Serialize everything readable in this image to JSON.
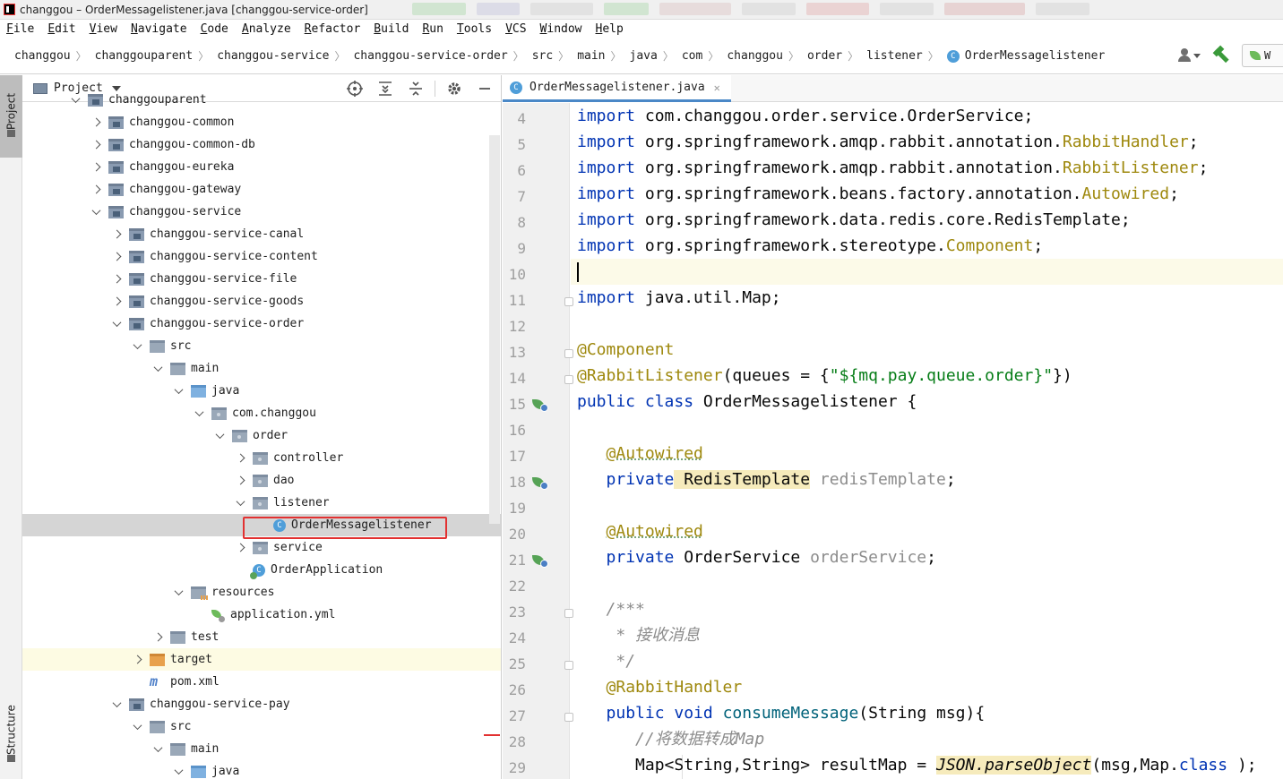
{
  "window": {
    "title": "changgou – OrderMessagelistener.java [changgou-service-order]"
  },
  "menu": [
    "File",
    "Edit",
    "View",
    "Navigate",
    "Code",
    "Analyze",
    "Refactor",
    "Build",
    "Run",
    "Tools",
    "VCS",
    "Window",
    "Help"
  ],
  "breadcrumb": [
    "changgou",
    "changgouparent",
    "changgou-service",
    "changgou-service-order",
    "src",
    "main",
    "java",
    "com",
    "changgou",
    "order",
    "listener",
    "OrderMessagelistener"
  ],
  "toolbar": {
    "run_config_label": "W"
  },
  "left_strip": {
    "project_tab": "Project",
    "structure_tab": "Structure"
  },
  "project_panel": {
    "title": "Project",
    "tree": [
      {
        "label": "changgouparent",
        "icon": "module",
        "depth": 0,
        "arrow": "open"
      },
      {
        "label": "changgou-common",
        "icon": "module",
        "depth": 1,
        "arrow": "closed"
      },
      {
        "label": "changgou-common-db",
        "icon": "module",
        "depth": 1,
        "arrow": "closed"
      },
      {
        "label": "changgou-eureka",
        "icon": "module",
        "depth": 1,
        "arrow": "closed"
      },
      {
        "label": "changgou-gateway",
        "icon": "module",
        "depth": 1,
        "arrow": "closed"
      },
      {
        "label": "changgou-service",
        "icon": "module",
        "depth": 1,
        "arrow": "open"
      },
      {
        "label": "changgou-service-canal",
        "icon": "module",
        "depth": 2,
        "arrow": "closed"
      },
      {
        "label": "changgou-service-content",
        "icon": "module",
        "depth": 2,
        "arrow": "closed"
      },
      {
        "label": "changgou-service-file",
        "icon": "module",
        "depth": 2,
        "arrow": "closed"
      },
      {
        "label": "changgou-service-goods",
        "icon": "module",
        "depth": 2,
        "arrow": "closed"
      },
      {
        "label": "changgou-service-order",
        "icon": "module",
        "depth": 2,
        "arrow": "open"
      },
      {
        "label": "src",
        "icon": "folder",
        "depth": 3,
        "arrow": "open"
      },
      {
        "label": "main",
        "icon": "folder",
        "depth": 4,
        "arrow": "open"
      },
      {
        "label": "java",
        "icon": "folder-blue",
        "depth": 5,
        "arrow": "open"
      },
      {
        "label": "com.changgou",
        "icon": "package",
        "depth": 6,
        "arrow": "open"
      },
      {
        "label": "order",
        "icon": "package",
        "depth": 7,
        "arrow": "open"
      },
      {
        "label": "controller",
        "icon": "package",
        "depth": 8,
        "arrow": "closed"
      },
      {
        "label": "dao",
        "icon": "package",
        "depth": 8,
        "arrow": "closed"
      },
      {
        "label": "listener",
        "icon": "package",
        "depth": 8,
        "arrow": "open"
      },
      {
        "label": "OrderMessagelistener",
        "icon": "class",
        "depth": 9,
        "arrow": "none",
        "selected": true
      },
      {
        "label": "service",
        "icon": "package",
        "depth": 8,
        "arrow": "closed"
      },
      {
        "label": "OrderApplication",
        "icon": "app-class",
        "depth": 8,
        "arrow": "none"
      },
      {
        "label": "resources",
        "icon": "folder-res",
        "depth": 5,
        "arrow": "open"
      },
      {
        "label": "application.yml",
        "icon": "yml",
        "depth": 6,
        "arrow": "none"
      },
      {
        "label": "test",
        "icon": "folder",
        "depth": 4,
        "arrow": "closed"
      },
      {
        "label": "target",
        "icon": "folder-orange",
        "depth": 3,
        "arrow": "closed",
        "highlight": true
      },
      {
        "label": "pom.xml",
        "icon": "maven",
        "depth": 3,
        "arrow": "none"
      },
      {
        "label": "changgou-service-pay",
        "icon": "module",
        "depth": 2,
        "arrow": "open"
      },
      {
        "label": "src",
        "icon": "folder",
        "depth": 3,
        "arrow": "open"
      },
      {
        "label": "main",
        "icon": "folder",
        "depth": 4,
        "arrow": "open"
      },
      {
        "label": "java",
        "icon": "folder-blue",
        "depth": 5,
        "arrow": "open"
      }
    ]
  },
  "editor": {
    "tab_label": "OrderMessagelistener.java",
    "tab_icon": "C",
    "line_numbers": [
      "4",
      "5",
      "6",
      "7",
      "8",
      "9",
      "10",
      "11",
      "12",
      "13",
      "14",
      "15",
      "16",
      "17",
      "18",
      "19",
      "20",
      "21",
      "22",
      "23",
      "24",
      "25",
      "26",
      "27",
      "28",
      "29"
    ],
    "current_line": "10",
    "code_lines": [
      [
        [
          "kw",
          "import"
        ],
        [
          "",
          "com.changgou.order.service.OrderService;"
        ]
      ],
      [
        [
          "kw",
          "import"
        ],
        [
          "",
          "org.springframework.amqp.rabbit.annotation."
        ],
        [
          "ann",
          "RabbitHandler"
        ],
        [
          "",
          ";"
        ]
      ],
      [
        [
          "kw",
          "import"
        ],
        [
          "",
          "org.springframework.amqp.rabbit.annotation."
        ],
        [
          "ann",
          "RabbitListener"
        ],
        [
          "",
          ";"
        ]
      ],
      [
        [
          "kw",
          "import"
        ],
        [
          "",
          "org.springframework.beans.factory.annotation."
        ],
        [
          "ann",
          "Autowired"
        ],
        [
          "",
          ";"
        ]
      ],
      [
        [
          "kw",
          "import"
        ],
        [
          "",
          "org.springframework.data.redis.core.RedisTemplate;"
        ]
      ],
      [
        [
          "kw",
          "import"
        ],
        [
          "",
          "org.springframework.stereotype."
        ],
        [
          "ann",
          "Component"
        ],
        [
          "",
          ";"
        ]
      ],
      [
        [
          "caret",
          ""
        ]
      ],
      [
        [
          "kw",
          "import"
        ],
        [
          "",
          "java.util.Map;"
        ]
      ],
      [],
      [
        [
          "ann",
          "@Component"
        ]
      ],
      [
        [
          "ann",
          "@RabbitListener"
        ],
        [
          "",
          "(queues = {"
        ],
        [
          "str",
          "\"${mq.pay.queue.order}\""
        ],
        [
          "",
          "})"
        ]
      ],
      [
        [
          "kw",
          "public class"
        ],
        [
          "",
          "OrderMessagelistener {"
        ]
      ],
      [],
      [
        [
          "",
          "   "
        ],
        [
          "ann-u",
          "@Autowired"
        ]
      ],
      [
        [
          "",
          "   "
        ],
        [
          "kw",
          "private"
        ],
        [
          "warn",
          " RedisTemplate"
        ],
        [
          "dim",
          " redisTemplate"
        ],
        [
          "",
          ";"
        ]
      ],
      [],
      [
        [
          "",
          "   "
        ],
        [
          "ann-u",
          "@Autowired"
        ]
      ],
      [
        [
          "",
          "   "
        ],
        [
          "kw",
          "private"
        ],
        [
          "",
          " OrderService "
        ],
        [
          "dim",
          "orderService"
        ],
        [
          "",
          ";"
        ]
      ],
      [],
      [
        [
          "",
          "   "
        ],
        [
          "cmt",
          "/***"
        ]
      ],
      [
        [
          "",
          "    "
        ],
        [
          "cmt",
          "* 接收消息"
        ]
      ],
      [
        [
          "",
          "    "
        ],
        [
          "cmt",
          "*/"
        ]
      ],
      [
        [
          "",
          "   "
        ],
        [
          "ann",
          "@RabbitHandler"
        ]
      ],
      [
        [
          "",
          "   "
        ],
        [
          "kw",
          "public void"
        ],
        [
          "fn",
          " consumeMessage"
        ],
        [
          "",
          "(String msg){"
        ]
      ],
      [
        [
          "",
          "      "
        ],
        [
          "cmt",
          "//将数据转成Map"
        ]
      ],
      [
        [
          "",
          "      "
        ],
        [
          "",
          "Map<String,String> resultMap = "
        ],
        [
          "warn-i",
          "JSON.parseObject"
        ],
        [
          "",
          "(msg,Map."
        ],
        [
          "kw",
          "class"
        ],
        [
          "",
          ");"
        ]
      ]
    ]
  }
}
